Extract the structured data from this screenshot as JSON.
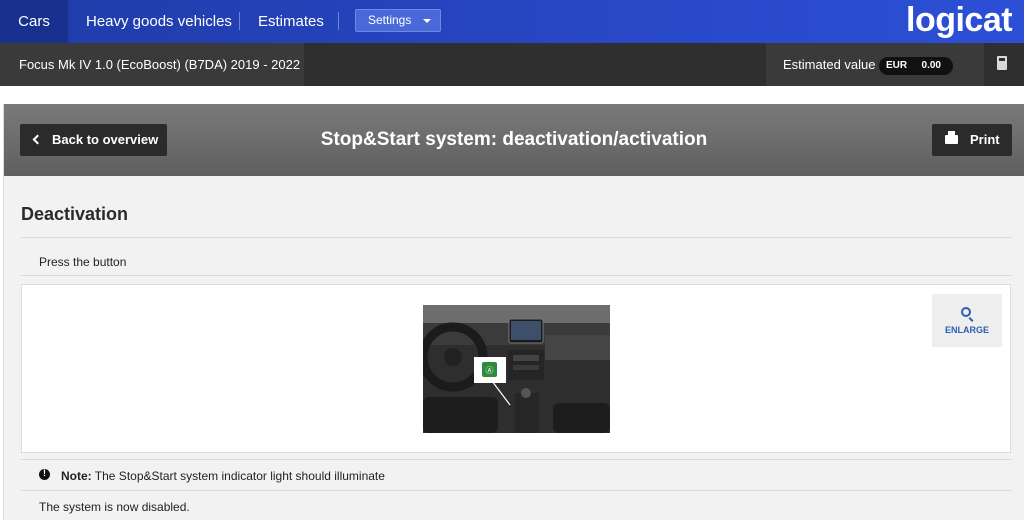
{
  "topnav": {
    "tabs": [
      {
        "label": "Cars",
        "active": true
      },
      {
        "label": "Heavy goods vehicles",
        "active": false
      },
      {
        "label": "Estimates",
        "active": false
      }
    ],
    "settings_label": "Settings",
    "logo_text": "logicat"
  },
  "vehicle_bar": {
    "vehicle_name": "Focus Mk IV 1.0 (EcoBoost) (B7DA) 2019 - 2022",
    "estimated_label": "Estimated value",
    "currency": "EUR",
    "value": "0.00"
  },
  "header": {
    "back_label": "Back to overview",
    "title": "Stop&Start system: deactivation/activation",
    "print_label": "Print"
  },
  "content": {
    "section_title": "Deactivation",
    "instruction": "Press the button",
    "enlarge_label": "ENLARGE",
    "note_prefix": "Note:",
    "note_text": "The Stop&Start system indicator light should illuminate",
    "status_text": "The system is now disabled."
  },
  "colors": {
    "nav_blue": "#2747c4",
    "nav_active": "#18318f",
    "link_blue": "#2a5fb0",
    "dark_bar": "#2f2f2f"
  }
}
